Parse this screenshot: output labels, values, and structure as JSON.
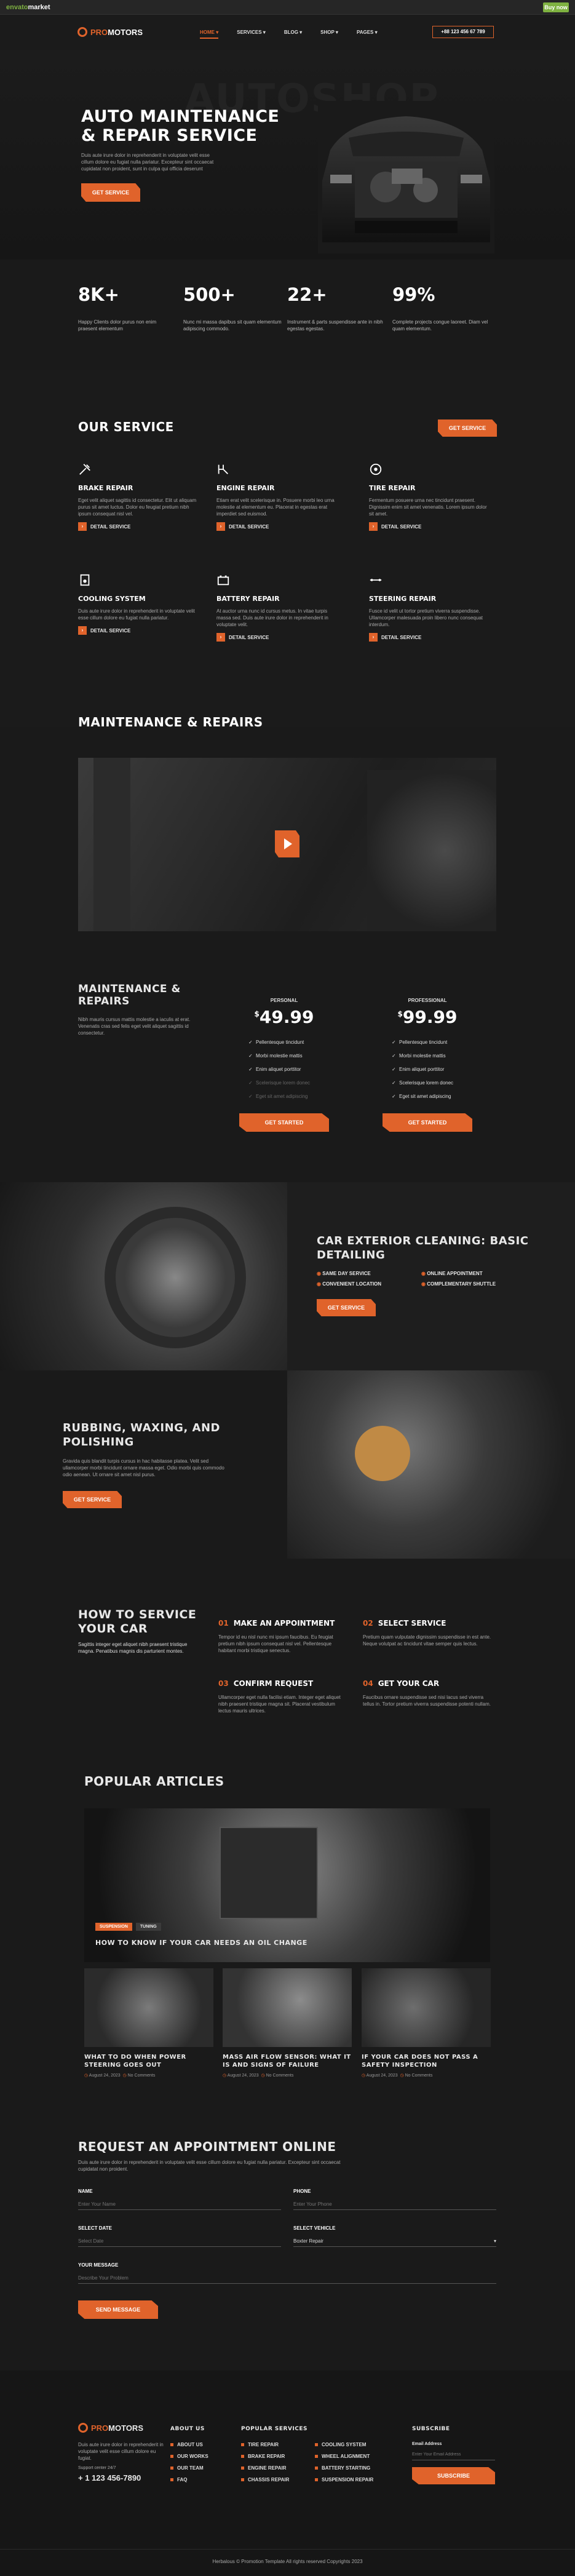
{
  "envato_bar": {
    "logo_a": "envato",
    "logo_b": "market",
    "buy": "Buy now"
  },
  "nav": {
    "logo_a": "PRO",
    "logo_b": "MOTORS",
    "items": [
      "HOME",
      "SERVICES",
      "BLOG",
      "SHOP",
      "PAGES"
    ],
    "phone": "+88 123 456 67 789"
  },
  "hero": {
    "ghost": "AUTOSHOP",
    "title": "AUTO MAINTENANCE & REPAIR SERVICE",
    "text": "Duis aute irure dolor in reprehenderit in voluptate velit esse cillum dolore eu fugiat nulla pariatur. Excepteur sint occaecat cupidatat non proident, sunt in culpa qui officia deserunt",
    "button": "GET SERVICE"
  },
  "stats": [
    {
      "num": "8K+",
      "text": "Happy Clients dolor purus non enim praesent elementum"
    },
    {
      "num": "500+",
      "text": "Nunc mi massa dapibus sit quam elementum adipiscing commodo."
    },
    {
      "num": "22+",
      "text": "Instrument & parts suspendisse ante in nibh egestas egestas."
    },
    {
      "num": "99%",
      "text": "Complete projects congue laoreet. Diam vel quam elementum."
    }
  ],
  "services": {
    "title": "OUR SERVICE",
    "button": "GET SERVICE",
    "detail": "DETAIL SERVICE",
    "items": [
      {
        "icon": "tools-icon",
        "title": "BRAKE REPAIR",
        "text": "Eget velit aliquet sagittis id consectetur. Elit ut aliquam purus sit amet luctus. Dolor eu feugiat pretium nibh ipsum consequat nisl vel."
      },
      {
        "icon": "engine-icon",
        "title": "ENGINE REPAIR",
        "text": "Etiam erat velit scelerisque in. Posuere morbi leo urna molestie at elementum eu. Placerat in egestas erat imperdiet sed euismod."
      },
      {
        "icon": "tire-icon",
        "title": "TIRE REPAIR",
        "text": "Fermentum posuere urna nec tincidunt praesent. Dignissim enim sit amet venenatis. Lorem ipsum dolor sit amet."
      },
      {
        "icon": "cooling-icon",
        "title": "COOLING SYSTEM",
        "text": "Duis aute irure dolor in reprehenderit in voluptate velit esse cillum dolore eu fugiat nulla pariatur."
      },
      {
        "icon": "battery-icon",
        "title": "BATTERY REPAIR",
        "text": "At auctor urna nunc id cursus metus. In vitae turpis massa sed. Duis aute irure dolor in reprehenderit in voluptate velit."
      },
      {
        "icon": "steering-icon",
        "title": "STEERING REPAIR",
        "text": "Fusce id velit ut tortor pretium viverra suspendisse. Ullamcorper malesuada proin libero nunc consequat interdum."
      }
    ]
  },
  "video": {
    "title": "MAINTENANCE & REPAIRS"
  },
  "pricing": {
    "title": "MAINTENANCE & REPAIRS",
    "text": "Nibh mauris cursus mattis molestie a iaculis at erat. Venenatis cras sed felis eget velit aliquet sagittis id consectetur.",
    "button": "GET STARTED",
    "plans": [
      {
        "label": "PERSONAL",
        "price": "49.99",
        "features": [
          {
            "t": "Pellentesque tincidunt",
            "on": true
          },
          {
            "t": "Morbi molestie mattis",
            "on": true
          },
          {
            "t": "Enim aliquet porttitor",
            "on": true
          },
          {
            "t": "Scelerisque lorem donec",
            "on": false
          },
          {
            "t": "Eget sit amet adipiscing",
            "on": false
          }
        ]
      },
      {
        "label": "PROFESSIONAL",
        "price": "99.99",
        "features": [
          {
            "t": "Pellentesque tincidunt",
            "on": true
          },
          {
            "t": "Morbi molestie mattis",
            "on": true
          },
          {
            "t": "Enim aliquet porttitor",
            "on": true
          },
          {
            "t": "Scelerisque lorem donec",
            "on": true
          },
          {
            "t": "Eget sit amet adipiscing",
            "on": true
          }
        ]
      }
    ]
  },
  "exterior": {
    "title": "CAR EXTERIOR CLEANING: BASIC DETAILING",
    "list": [
      "SAME DAY SERVICE",
      "ONLINE APPOINTMENT",
      "CONVENIENT LOCATION",
      "COMPLEMENTARY SHUTTLE"
    ],
    "button": "GET SERVICE"
  },
  "rubbing": {
    "title": "RUBBING, WAXING, AND POLISHING",
    "text": "Gravida quis blandit turpis cursus in hac habitasse platea. Velit sed ullamcorper morbi tincidunt ornare massa eget. Odio morbi quis commodo odio aenean. Ut ornare sit amet nisl purus.",
    "button": "GET SERVICE"
  },
  "how": {
    "title": "HOW TO SERVICE YOUR CAR",
    "text": "Sagittis integer eget aliquet nibh praesent tristique magna. Penatibus magnis dis parturient montes.",
    "steps": [
      {
        "n": "01",
        "title": "MAKE AN APPOINTMENT",
        "text": "Tempor id eu nisl nunc mi ipsum faucibus. Eu feugiat pretium nibh ipsum consequat nisl vel. Pellentesque habitant morbi tristique senectus."
      },
      {
        "n": "02",
        "title": "SELECT SERVICE",
        "text": "Pretium quam vulputate dignissim suspendisse in est ante. Neque volutpat ac tincidunt vitae semper quis lectus."
      },
      {
        "n": "03",
        "title": "CONFIRM REQUEST",
        "text": "Ullamcorper eget nulla facilisi etiam. Integer eget aliquet nibh praesent tristique magna sit. Placerat vestibulum lectus mauris ultrices."
      },
      {
        "n": "04",
        "title": "GET YOUR CAR",
        "text": "Faucibus ornare suspendisse sed nisi lacus sed viverra tellus in. Tortor pretium viverra suspendisse potenti nullam."
      }
    ]
  },
  "articles": {
    "title": "POPULAR ARTICLES",
    "featured": {
      "tags": [
        "SUSPENSION",
        "TUNING"
      ],
      "title": "HOW TO KNOW IF YOUR CAR NEEDS AN OIL CHANGE"
    },
    "items": [
      {
        "title": "WHAT TO DO WHEN POWER STEERING GOES OUT",
        "date": "August 24, 2023",
        "comments": "No Comments"
      },
      {
        "title": "MASS AIR FLOW SENSOR: WHAT IT IS AND SIGNS OF FAILURE",
        "date": "August 24, 2023",
        "comments": "No Comments"
      },
      {
        "title": "IF YOUR CAR DOES NOT PASS A SAFETY INSPECTION",
        "date": "August 24, 2023",
        "comments": "No Comments"
      }
    ]
  },
  "appointment": {
    "title": "REQUEST AN APPOINTMENT ONLINE",
    "text": "Duis aute irure dolor in reprehenderit in voluptate velit esse cillum dolore eu fugiat nulla pariatur. Excepteur sint occaecat cupidatat non proident.",
    "name_label": "NAME",
    "name_ph": "Enter Your Name",
    "phone_label": "PHONE",
    "phone_ph": "Enter Your Phone",
    "date_label": "SELECT DATE",
    "date_ph": "Select Date",
    "vehicle_label": "SELECT VEHICLE",
    "vehicle_val": "Boxter Repair",
    "msg_label": "YOUR MESSAGE",
    "msg_ph": "Describe Your Problem",
    "button": "SEND MESSAGE"
  },
  "footer": {
    "logo_a": "PRO",
    "logo_b": "MOTORS",
    "text": "Duis aute irure dolor in reprehenderit in voluptate velit esse cillum dolore eu fugiat.",
    "support": "Support center 24/7",
    "phone": "+ 1 123 456-7890",
    "about_title": "ABOUT US",
    "about": [
      "ABOUT US",
      "OUR WORKS",
      "OUR TEAM",
      "FAQ"
    ],
    "services_title": "POPULAR SERVICES",
    "services_a": [
      "TIRE REPAIR",
      "BRAKE REPAIR",
      "ENGINE REPAIR",
      "CHASSIS REPAIR"
    ],
    "services_b": [
      "COOLING SYSTEM",
      "WHEEL ALIGNMENT",
      "BATTERY STARTING",
      "SUSPENSION REPAIR"
    ],
    "sub_title": "SUBSCRIBE",
    "email_label": "Email Address",
    "email_ph": "Enter Your Email Address",
    "sub_btn": "SUBSCRIBE",
    "copyright": "Herbalous © Promotion Template All rights reserved Copyrights 2023"
  }
}
